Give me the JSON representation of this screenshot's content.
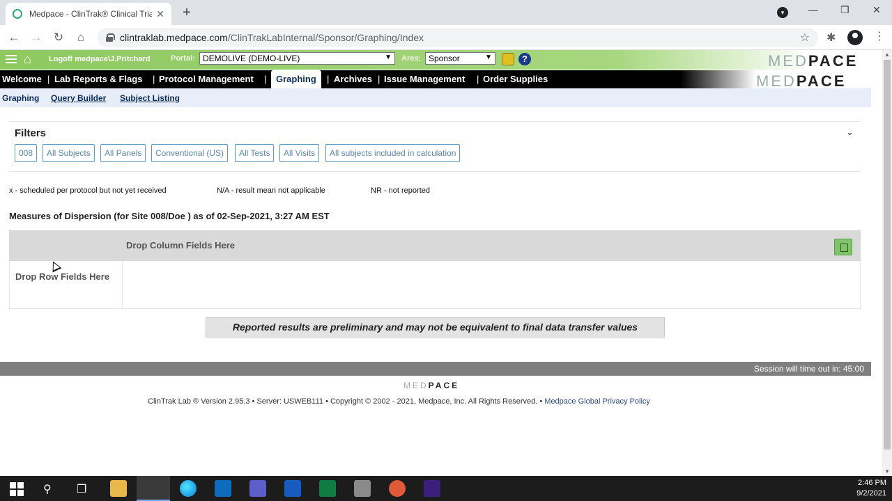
{
  "browser": {
    "tab_title": "Medpace - ClinTrak® Clinical Tria",
    "tab_close": "✕",
    "new_tab": "+",
    "url_domain": "clintraklab.medpace.com",
    "url_path": "/ClinTrakLabInternal/Sponsor/Graphing/Index",
    "back": "←",
    "forward": "→",
    "reload": "↻",
    "home": "⌂",
    "star": "☆",
    "ext": "✱",
    "menu": "⋮",
    "min": "—",
    "max": "❐",
    "close": "✕"
  },
  "header": {
    "logoff": "Logoff medpace\\J.Pritchard",
    "portal_label": "Portal:",
    "portal_value": "DEMOLIVE (DEMO-LIVE)",
    "area_label": "Area:",
    "area_value": "Sponsor",
    "help": "?",
    "logo_light": "MED",
    "logo_dark": "PACE"
  },
  "nav": {
    "items": [
      "Welcome",
      "Lab Reports & Flags",
      "Protocol Management",
      "Graphing",
      "Archives",
      "Issue Management",
      "Order Supplies"
    ],
    "separator": "|",
    "active": "Graphing"
  },
  "subnav": [
    "Graphing",
    "Query Builder",
    "Subject Listing"
  ],
  "filters": {
    "title": "Filters",
    "toggle": "⌄",
    "chips": [
      "008",
      "All Subjects",
      "All Panels",
      "Conventional (US)",
      "All Tests",
      "All Visits",
      "All subjects included in calculation"
    ]
  },
  "legend": [
    "x - scheduled per protocol but not yet received",
    "N/A - result mean not applicable",
    "NR - not reported"
  ],
  "measures_title": "Measures of Dispersion (for Site 008/Doe ) as of 02-Sep-2021, 3:27 AM EST",
  "pivot": {
    "drop_columns": "Drop Column Fields Here",
    "drop_rows": "Drop Row Fields Here"
  },
  "disclaimer": "Reported results are preliminary and may not be equivalent to final data transfer values",
  "session": "Session will time out in: 45:00",
  "footer": {
    "logo_light": "MED",
    "logo_dark": "PACE",
    "text": "ClinTrak Lab ® Version 2.95.3 • Server: USWEB111 • Copyright © 2002 - 2021, Medpace, Inc. All Rights Reserved. • ",
    "link": "Medpace Global Privacy Policy"
  },
  "taskbar": {
    "search": "⚲",
    "taskview": "❐",
    "time": "2:46 PM",
    "date": "9/2/2021"
  }
}
